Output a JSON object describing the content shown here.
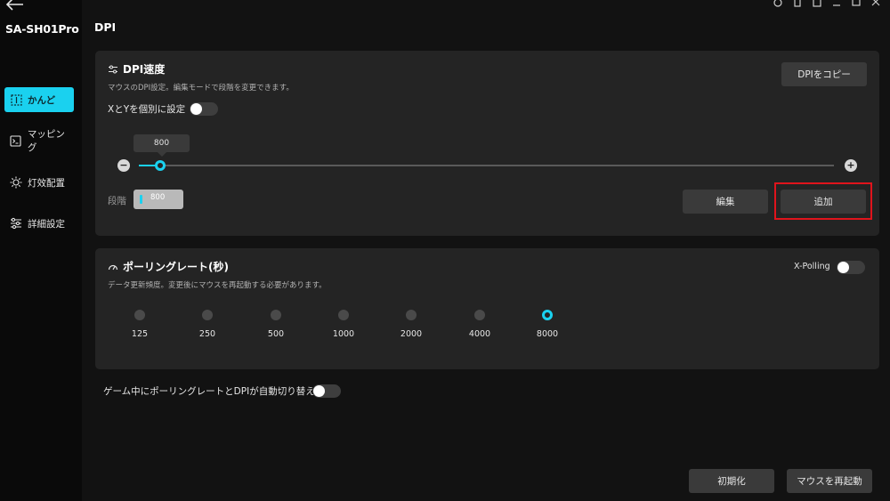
{
  "sidebar": {
    "device_name": "SA-SH01Pro",
    "items": [
      {
        "label": "かんど",
        "icon": "dpi-grid-icon",
        "active": true
      },
      {
        "label": "マッピング",
        "icon": "mapping-icon",
        "active": false
      },
      {
        "label": "灯效配置",
        "icon": "light-sun-icon",
        "active": false
      },
      {
        "label": "詳細設定",
        "icon": "sliders-icon",
        "active": false
      }
    ]
  },
  "header": {
    "title": "DPI"
  },
  "dpi_card": {
    "title": "DPI速度",
    "description": "マウスのDPI設定。編集モードで段階を変更できます。",
    "copy_button": "DPIをコピー",
    "xy_toggle_label": "XとYを個別に設定",
    "xy_toggle_on": false,
    "slider_value": "800",
    "slider_fraction": 0.031,
    "minus_symbol": "−",
    "plus_symbol": "+",
    "stage_label": "段階",
    "stage_value": "800",
    "edit_button": "編集",
    "add_button": "追加"
  },
  "polling_card": {
    "title": "ポーリングレート(秒)",
    "description": "データ更新頻度。変更後にマウスを再起動する必要があります。",
    "xpolling_label": "X-Polling",
    "xpolling_on": false,
    "rates": [
      "125",
      "250",
      "500",
      "1000",
      "2000",
      "4000",
      "8000"
    ],
    "selected_rate": "8000"
  },
  "auto_switch": {
    "label": "ゲーム中にポーリングレートとDPIが自動切り替え",
    "on": false
  },
  "footer": {
    "reset_button": "初期化",
    "restart_button": "マウスを再起動"
  },
  "colors": {
    "accent": "#1ad1ef",
    "highlight": "#e0141c",
    "card_bg": "#242424",
    "page_bg": "#121212"
  }
}
